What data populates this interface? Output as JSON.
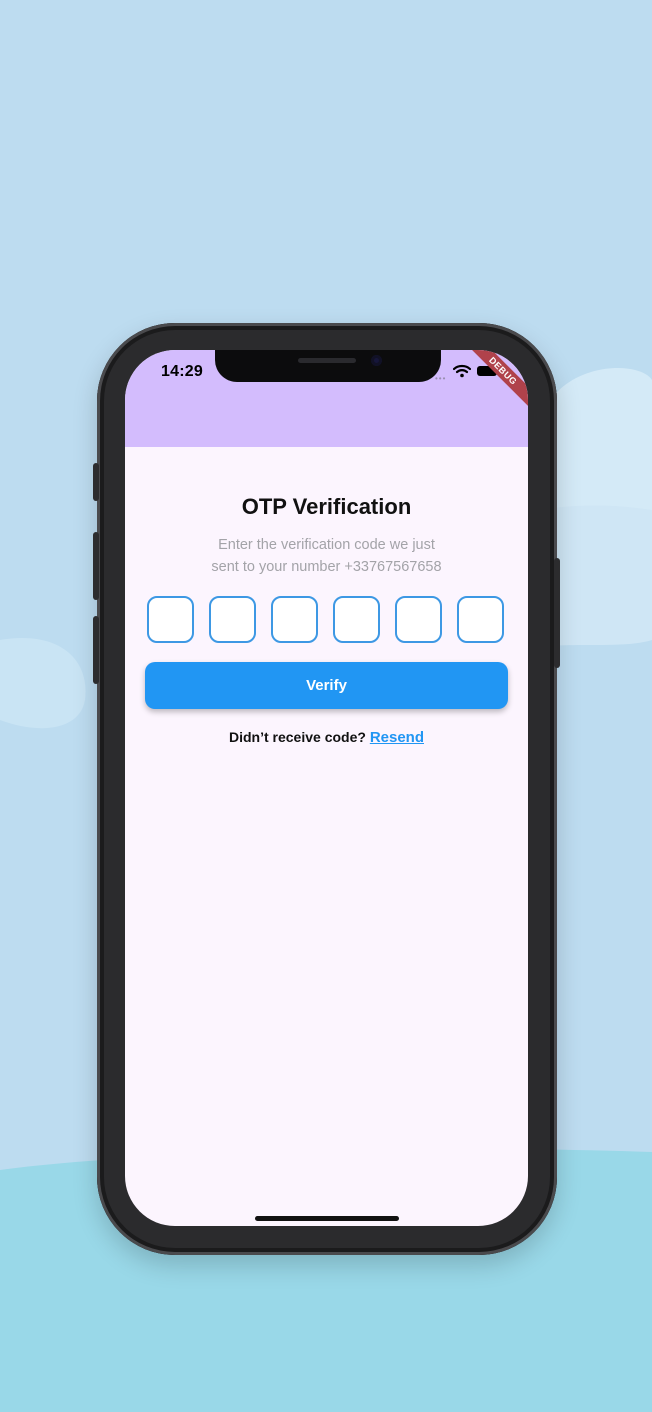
{
  "colors": {
    "background_sky": "#bddcf0",
    "background_ground": "#99d8e8",
    "appbar": "#d3bcfd",
    "screen": "#fcf5fe",
    "accent": "#2196f3",
    "otp_border": "#3d98e4",
    "debug_banner": "#b0424b"
  },
  "status_bar": {
    "time": "14:29",
    "wifi_icon": "wifi-icon",
    "battery_icon": "battery-icon",
    "debug_label": "DEBUG"
  },
  "main": {
    "title": "OTP Verification",
    "subtitle_line1": "Enter the verification code we just",
    "subtitle_line2": "sent to your number +33767567658",
    "otp_digits": [
      "",
      "",
      "",
      "",
      "",
      ""
    ],
    "verify_label": "Verify",
    "resend_prompt": "Didn’t receive code?",
    "resend_label": "Resend"
  }
}
